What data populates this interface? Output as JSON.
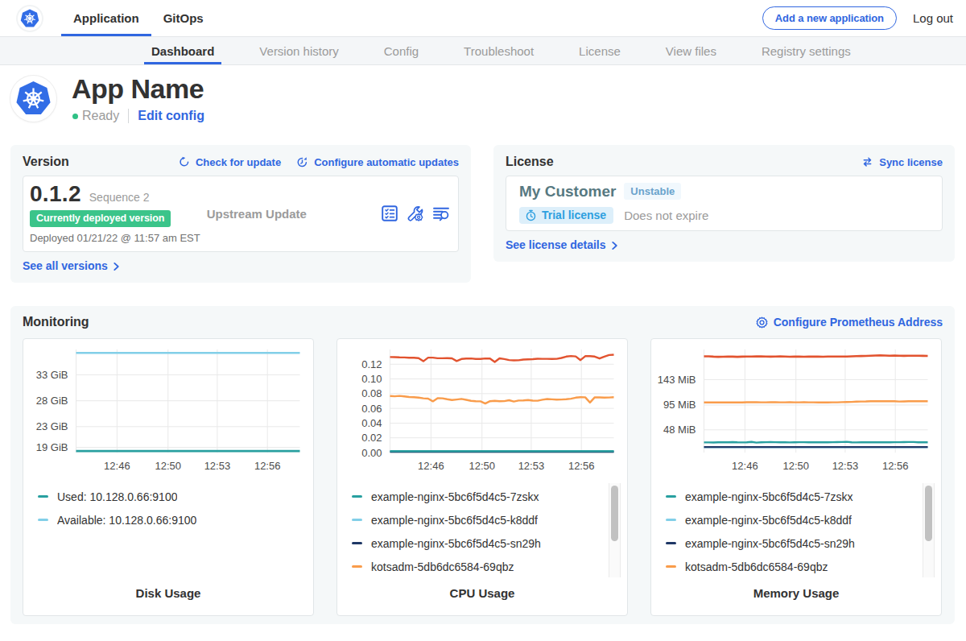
{
  "navbar": {
    "application_tab": "Application",
    "gitops_tab": "GitOps",
    "add_application_button": "Add a new application",
    "logout_label": "Log out"
  },
  "subnav": {
    "items": [
      {
        "label": "Dashboard",
        "active": true
      },
      {
        "label": "Version history",
        "active": false
      },
      {
        "label": "Config",
        "active": false
      },
      {
        "label": "Troubleshoot",
        "active": false
      },
      {
        "label": "License",
        "active": false
      },
      {
        "label": "View files",
        "active": false
      },
      {
        "label": "Registry settings",
        "active": false
      }
    ]
  },
  "header": {
    "app_name": "App Name",
    "status": "Ready",
    "edit_config": "Edit config"
  },
  "version_card": {
    "title": "Version",
    "check_for_update": "Check for update",
    "configure_automatic_updates": "Configure automatic updates",
    "version_number": "0.1.2",
    "sequence": "Sequence 2",
    "deployed_tag": "Currently deployed version",
    "deployed_at": "Deployed 01/21/22 @ 11:57 am EST",
    "source": "Upstream Update",
    "icons": [
      "preflight-checks-icon",
      "config-wrench-icon",
      "deploy-logs-icon"
    ],
    "see_all_versions": "See all versions"
  },
  "license_card": {
    "title": "License",
    "sync_license": "Sync license",
    "customer_name": "My Customer",
    "channel": "Unstable",
    "license_type": "Trial license",
    "expiry": "Does not expire",
    "see_license_details": "See license details"
  },
  "monitoring": {
    "title": "Monitoring",
    "configure_link": "Configure Prometheus Address"
  },
  "colors": {
    "primary_blue": "#3066e0",
    "k8s_blue": "#326de6",
    "green_tag": "#3bc48a",
    "status_green": "#2fc185",
    "teal_series": "#28a0a0",
    "light_blue_series": "#82cfe8",
    "navy_series": "#1f3866",
    "orange_series": "#f99c4b",
    "red_series": "#e2532f"
  },
  "chart_data": [
    {
      "type": "line",
      "title": "Disk Usage",
      "x_ticks": [
        "12:46",
        "12:50",
        "12:53",
        "12:56"
      ],
      "x_tick_fracs": [
        0.183,
        0.411,
        0.631,
        0.855
      ],
      "y_ticks": [
        {
          "value": 19,
          "label": "19 GiB"
        },
        {
          "value": 23,
          "label": "23 GiB"
        },
        {
          "value": 28,
          "label": "28 GiB"
        },
        {
          "value": 33,
          "label": "33 GiB"
        }
      ],
      "ylim": [
        18.0,
        37.9
      ],
      "legend_scrollbar": false,
      "series": [
        {
          "name": "Available: 10.128.0.66:9100",
          "color": "#82cfe8",
          "width": 2.4,
          "legend_order": 2,
          "values": [
            37.25,
            37.25
          ]
        },
        {
          "name": "Used: 10.128.0.66:9100",
          "color": "#28a0a0",
          "width": 2.6,
          "legend_order": 1,
          "values": [
            18.3,
            18.3
          ]
        }
      ]
    },
    {
      "type": "line",
      "title": "CPU Usage",
      "x_ticks": [
        "12:46",
        "12:50",
        "12:53",
        "12:56"
      ],
      "x_tick_fracs": [
        0.183,
        0.411,
        0.631,
        0.855
      ],
      "y_ticks": [
        {
          "value": 0.0,
          "label": "0.00"
        },
        {
          "value": 0.02,
          "label": "0.02"
        },
        {
          "value": 0.04,
          "label": "0.04"
        },
        {
          "value": 0.06,
          "label": "0.06"
        },
        {
          "value": 0.08,
          "label": "0.08"
        },
        {
          "value": 0.1,
          "label": "0.10"
        },
        {
          "value": 0.12,
          "label": "0.12"
        }
      ],
      "ylim": [
        0,
        0.14
      ],
      "legend_scrollbar": true,
      "series": [
        {
          "name": "example-nginx-5bc6f5d4c5-k8ddf",
          "color": "#82cfe8",
          "width": 2,
          "legend_order": 2,
          "values": [
            0.0015,
            0.0015
          ]
        },
        {
          "name": "example-nginx-5bc6f5d4c5-sn29h",
          "color": "#1f3866",
          "width": 2,
          "legend_order": 3,
          "values": [
            0.0008,
            0.0008
          ]
        },
        {
          "name": "example-nginx-5bc6f5d4c5-7zskx",
          "color": "#28a0a0",
          "width": 2.4,
          "legend_order": 1,
          "values": [
            0.002,
            0.002
          ]
        },
        {
          "name": "kotsadm-5db6dc6584-69qbz",
          "color": "#f99c4b",
          "width": 2.4,
          "legend_order": 4,
          "values": [
            0.0768,
            0.0765,
            0.077,
            0.0763,
            0.0755,
            0.0751,
            0.0746,
            0.0737,
            0.0733,
            0.0696,
            0.0739,
            0.0737,
            0.0724,
            0.0713,
            0.0721,
            0.0728,
            0.0716,
            0.0703,
            0.0697,
            0.0696,
            0.0666,
            0.0698,
            0.0703,
            0.0698,
            0.0699,
            0.0711,
            0.0693,
            0.0707,
            0.0709,
            0.0713,
            0.0706,
            0.0704,
            0.0717,
            0.0727,
            0.0723,
            0.0719,
            0.0721,
            0.0724,
            0.0732,
            0.0746,
            0.0752,
            0.075,
            0.0679,
            0.075,
            0.0749,
            0.0747,
            0.0748,
            0.0751
          ]
        },
        {
          "name": "",
          "color": "#e2532f",
          "width": 2.4,
          "legend_order": 5,
          "legend_hidden": true,
          "values": [
            0.1297,
            0.1296,
            0.1293,
            0.1292,
            0.1287,
            0.1287,
            0.1283,
            0.124,
            0.1289,
            0.129,
            0.1281,
            0.1281,
            0.1283,
            0.128,
            0.1243,
            0.1271,
            0.1277,
            0.1279,
            0.1272,
            0.1271,
            0.1279,
            0.1276,
            0.123,
            0.128,
            0.127,
            0.1257,
            0.1252,
            0.1253,
            0.1263,
            0.1267,
            0.1269,
            0.1274,
            0.1273,
            0.1273,
            0.1271,
            0.1273,
            0.1285,
            0.1304,
            0.1311,
            0.1306,
            0.1256,
            0.1309,
            0.131,
            0.1304,
            0.1278,
            0.1304,
            0.1325,
            0.1329
          ]
        }
      ]
    },
    {
      "type": "line",
      "title": "Memory Usage",
      "x_ticks": [
        "12:46",
        "12:50",
        "12:53",
        "12:56"
      ],
      "x_tick_fracs": [
        0.183,
        0.411,
        0.631,
        0.855
      ],
      "y_ticks": [
        {
          "value": 48,
          "label": "48 MiB"
        },
        {
          "value": 95,
          "label": "95 MiB"
        },
        {
          "value": 143,
          "label": "143 MiB"
        }
      ],
      "ylim": [
        5,
        200
      ],
      "legend_scrollbar": true,
      "series": [
        {
          "name": "example-nginx-5bc6f5d4c5-k8ddf",
          "color": "#82cfe8",
          "width": 2,
          "legend_order": 2,
          "values": [
            15.0,
            15.0
          ]
        },
        {
          "name": "example-nginx-5bc6f5d4c5-sn29h",
          "color": "#1f3866",
          "width": 2.2,
          "legend_order": 3,
          "values": [
            15.4,
            15.4
          ]
        },
        {
          "name": "example-nginx-5bc6f5d4c5-7zskx",
          "color": "#28a0a0",
          "width": 2.4,
          "legend_order": 1,
          "values": [
            24.2,
            24.2,
            24.1,
            24.5,
            24.4,
            24.5,
            24.8,
            24.4,
            24.2,
            24.4,
            25.3,
            23.9,
            24.3,
            24.7,
            24.8,
            24.7,
            24.5,
            24.3,
            24.2,
            24.4,
            24.6,
            24.6,
            24.5,
            24.3,
            24.3,
            24.4,
            24.5,
            24.6,
            24.8,
            24.9,
            25.4,
            24.3,
            24.2,
            24.5,
            24.6,
            24.4,
            24.5,
            24.7,
            24.5,
            24.5,
            24.7,
            24.7,
            24.8,
            25.0,
            24.9,
            24.5,
            24.4,
            24.4
          ]
        },
        {
          "name": "kotsadm-5db6dc6584-69qbz",
          "color": "#f99c4b",
          "width": 2.4,
          "legend_order": 4,
          "values": [
            99.8,
            99.8,
            99.9,
            99.8,
            99.8,
            99.7,
            99.8,
            99.7,
            99.9,
            100.2,
            100.3,
            100.2,
            100.0,
            100.1,
            100.3,
            100.2,
            100.0,
            100.1,
            100.2,
            100.0,
            100.0,
            100.2,
            100.0,
            100.0,
            99.8,
            99.7,
            99.8,
            100.0,
            100.1,
            100.4,
            100.5,
            100.9,
            101.4,
            101.6,
            101.8,
            102.2,
            102.0,
            102.0,
            102.2,
            102.2,
            102.0,
            101.6,
            101.7,
            102.0,
            102.1,
            102.2,
            102.1,
            102.1
          ]
        },
        {
          "name": "",
          "color": "#e2532f",
          "width": 2.6,
          "legend_order": 5,
          "legend_hidden": true,
          "values": [
            187.0,
            187.0,
            186.5,
            186.2,
            186.3,
            186.5,
            186.5,
            186.2,
            186.4,
            186.6,
            186.8,
            186.9,
            186.9,
            186.6,
            186.4,
            186.7,
            186.9,
            186.6,
            186.3,
            186.4,
            186.5,
            186.3,
            186.5,
            186.8,
            186.5,
            186.3,
            186.6,
            186.6,
            186.6,
            186.7,
            186.8,
            187.1,
            187.5,
            187.7,
            187.8,
            188.1,
            188.5,
            188.9,
            188.5,
            188.3,
            188.4,
            188.1,
            187.9,
            188.2,
            188.3,
            188.2,
            187.9,
            187.8
          ]
        }
      ]
    }
  ]
}
